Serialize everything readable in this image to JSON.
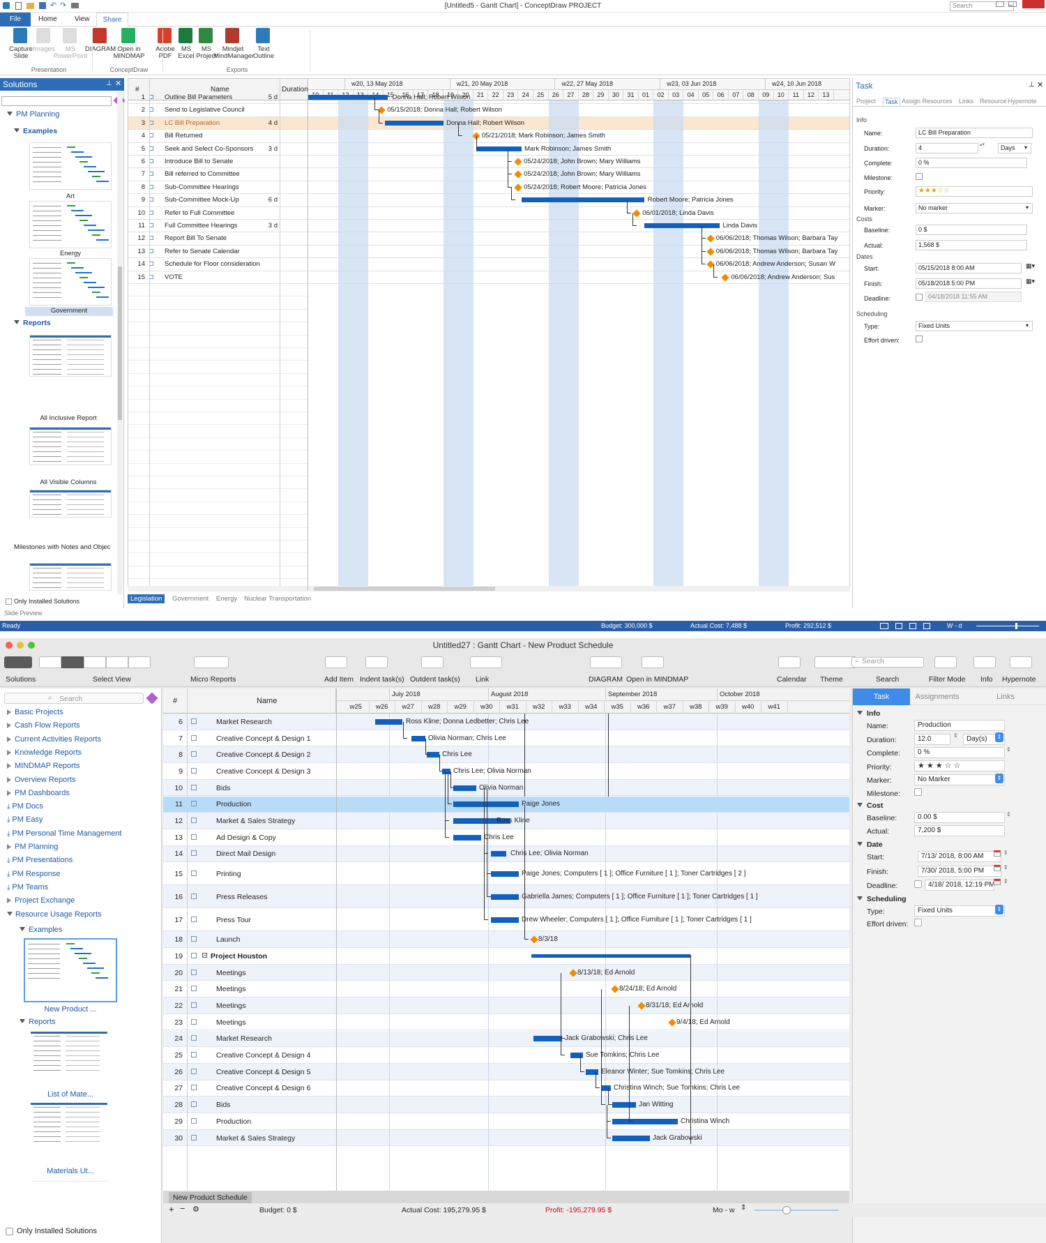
{
  "w1": {
    "title": "[Untitled5 - Gantt Chart] - ConceptDraw PROJECT",
    "search_placeholder": "Search",
    "tabs": [
      "File",
      "Home",
      "View",
      "Share"
    ],
    "ribbon": {
      "groups": [
        "Presentation",
        "ConceptDraw",
        "Exports"
      ],
      "buttons": [
        {
          "l1": "Capture",
          "l2": "Slide",
          "color": "#2d7ab8",
          "dis": false
        },
        {
          "l1": "Images",
          "l2": "",
          "color": "#bbb",
          "dis": true
        },
        {
          "l1": "MS",
          "l2": "PowerPoint",
          "color": "#bbb",
          "dis": true
        },
        {
          "l1": "DIAGRAM",
          "l2": "",
          "color": "#c0392b",
          "dis": false
        },
        {
          "l1": "Open in",
          "l2": "MINDMAP",
          "color": "#27ae60",
          "dis": false
        },
        {
          "l1": "Adobe",
          "l2": "PDF",
          "color": "#d9402b",
          "dis": false
        },
        {
          "l1": "MS",
          "l2": "Excel",
          "color": "#1d7a3e",
          "dis": false
        },
        {
          "l1": "MS",
          "l2": "Project",
          "color": "#2e8a3e",
          "dis": false
        },
        {
          "l1": "Mindjet",
          "l2": "MindManager",
          "color": "#b03a2e",
          "dis": false
        },
        {
          "l1": "Text",
          "l2": "Outline",
          "color": "#2d7ab8",
          "dis": false
        }
      ]
    },
    "solutions": {
      "title": "Solutions",
      "pm_planning": "PM Planning",
      "examples": "Examples",
      "reports": "Reports",
      "thumbs": [
        "Art",
        "Energy",
        "Government"
      ],
      "report_thumbs": [
        "All Inclusive Report",
        "All Visible Columns",
        "Milestones with Notes and Objec"
      ],
      "only_installed": "Only Installed Solutions",
      "slide_preview": "Slide Preview"
    },
    "grid": {
      "h_num": "#",
      "h_name": "Name",
      "h_dur": "Duration"
    },
    "tasks": [
      {
        "n": "1",
        "name": "Outline Bill Parameters",
        "dur": "5 d",
        "label": "Donna Hall; Robert Wilson"
      },
      {
        "n": "2",
        "name": "Send to Legislative Council",
        "dur": "",
        "label": "05/15/2018; Donna Hall; Robert Wilson"
      },
      {
        "n": "3",
        "name": "LC Bill Preparation",
        "dur": "4 d",
        "label": "Donna Hall; Robert Wilson"
      },
      {
        "n": "4",
        "name": "Bill Returned",
        "dur": "",
        "label": "05/21/2018; Mark Robinson; James Smith"
      },
      {
        "n": "5",
        "name": "Seek and Select Co-Sponsors",
        "dur": "3 d",
        "label": "Mark Robinson; James Smith"
      },
      {
        "n": "6",
        "name": "Introduce Bill to Senate",
        "dur": "",
        "label": "05/24/2018; John Brown; Mary Williams"
      },
      {
        "n": "7",
        "name": "Bill referred to Committee",
        "dur": "",
        "label": "05/24/2018; John Brown; Mary Williams"
      },
      {
        "n": "8",
        "name": "Sub-Committee Hearings",
        "dur": "",
        "label": "05/24/2018; Robert Moore; Patricia Jones"
      },
      {
        "n": "9",
        "name": "Sub-Committee Mock-Up",
        "dur": "6 d",
        "label": "Robert Moore; Patricia Jones"
      },
      {
        "n": "10",
        "name": "Refer to Full Committee",
        "dur": "",
        "label": "06/01/2018; Linda Davis"
      },
      {
        "n": "11",
        "name": "Full Committee Hearings",
        "dur": "3 d",
        "label": "Linda Davis"
      },
      {
        "n": "12",
        "name": "Report Bill To Senate",
        "dur": "",
        "label": "06/06/2018; Thomas Wilson; Barbara Tay"
      },
      {
        "n": "13",
        "name": "Refer to Senate Calendar",
        "dur": "",
        "label": "06/06/2018; Thomas Wilson; Barbara Tay"
      },
      {
        "n": "14",
        "name": "Schedule for Floor consideration",
        "dur": "",
        "label": "06/06/2018; Andrew Anderson; Susan W"
      },
      {
        "n": "15",
        "name": "VOTE",
        "dur": "",
        "label": "06/06/2018; Andrew Anderson; Sus"
      }
    ],
    "weeks": [
      "w20, 13 May 2018",
      "w21, 20 May 2018",
      "w22, 27 May 2018",
      "w23, 03 Jun 2018",
      "w24, 10 Jun 2018"
    ],
    "days": [
      "10",
      "11",
      "12",
      "13",
      "14",
      "15",
      "16",
      "17",
      "18",
      "19",
      "20",
      "21",
      "22",
      "23",
      "24",
      "25",
      "26",
      "27",
      "28",
      "29",
      "30",
      "31",
      "01",
      "02",
      "03",
      "04",
      "05",
      "06",
      "07",
      "08",
      "09",
      "10",
      "11",
      "12",
      "13"
    ],
    "sheet_tabs": [
      "Legislation",
      "Government",
      "Energy",
      "Nuclear Transportation"
    ],
    "task_panel": {
      "title": "Task",
      "tabs": [
        "Project",
        "Task",
        "Assign Resources",
        "Links",
        "Resource",
        "Hypernote"
      ],
      "info": "Info",
      "name_l": "Name:",
      "name": "LC Bill Preparation",
      "duration_l": "Duration:",
      "duration": "4",
      "duration_unit": "Days",
      "complete_l": "Complete:",
      "complete": "0 %",
      "milestone_l": "Milestone:",
      "priority_l": "Priority:",
      "priority": "★★★☆☆",
      "marker_l": "Marker:",
      "marker": "No marker",
      "costs": "Costs",
      "baseline_l": "Baseline:",
      "baseline": "0 $",
      "actual_l": "Actual:",
      "actual": "1,568 $",
      "dates": "Dates",
      "start_l": "Start:",
      "start": "05/15/2018   8:00 AM",
      "finish_l": "Finish:",
      "finish": "05/18/2018   5:00 PM",
      "deadline_l": "Deadline:",
      "deadline": "04/18/2018  11:55 AM",
      "scheduling": "Scheduling",
      "type_l": "Type:",
      "type": "Fixed Units",
      "effort_l": "Effort driven:"
    },
    "status": {
      "ready": "Ready",
      "budget": "Budget: 300,000 $",
      "actual": "Actual Cost: 7,488 $",
      "profit": "Profit: 292,512 $",
      "zoom": "W - d"
    }
  },
  "w2": {
    "title": "Untitled27 : Gantt Chart - New Product Schedule",
    "toolbar": [
      "Solutions",
      "Select View",
      "Micro Reports",
      "Add Item",
      "Indent task(s)",
      "Outdent task(s)",
      "Link",
      "DIAGRAM",
      "Open in MINDMAP",
      "Calendar",
      "Theme",
      "Search",
      "Filter Mode",
      "Info",
      "Hypernote"
    ],
    "search_placeholder": "Search",
    "sidebar_search": "Search",
    "tree": [
      {
        "t": "Basic Projects",
        "k": "c"
      },
      {
        "t": "Cash Flow Reports",
        "k": "c"
      },
      {
        "t": "Current Activities Reports",
        "k": "c"
      },
      {
        "t": "Knowledge Reports",
        "k": "c"
      },
      {
        "t": "MINDMAP Reports",
        "k": "c"
      },
      {
        "t": "Overview Reports",
        "k": "c"
      },
      {
        "t": "PM Dashboards",
        "k": "c"
      },
      {
        "t": "PM Docs",
        "k": "d"
      },
      {
        "t": "PM Easy",
        "k": "d"
      },
      {
        "t": "PM Personal Time Management",
        "k": "d"
      },
      {
        "t": "PM Planning",
        "k": "c"
      },
      {
        "t": "PM Presentations",
        "k": "d"
      },
      {
        "t": "PM Response",
        "k": "d"
      },
      {
        "t": "PM Teams",
        "k": "d"
      },
      {
        "t": "Project Exchange",
        "k": "c"
      },
      {
        "t": "Resource Usage Reports",
        "k": "o"
      }
    ],
    "examples": "Examples",
    "reports": "Reports",
    "thumbs": [
      "New Product ...",
      "List of Mate...",
      "Materials Ut..."
    ],
    "only_installed": "Only Installed Solutions",
    "grid": {
      "h_num": "#",
      "h_name": "Name"
    },
    "months": [
      "July 2018",
      "August 2018",
      "September 2018",
      "October 2018"
    ],
    "weeks": [
      "w25",
      "w26",
      "w27",
      "w28",
      "w29",
      "w30",
      "w31",
      "w32",
      "w33",
      "w34",
      "w35",
      "w36",
      "w37",
      "w38",
      "w39",
      "w40",
      "w41"
    ],
    "tasks": [
      {
        "n": "6",
        "name": "Market Research",
        "label": "Ross Kline; Donna Ledbetter; Chris Lee"
      },
      {
        "n": "7",
        "name": "Creative Concept & Design 1",
        "label": "Olivia Norman; Chris Lee"
      },
      {
        "n": "8",
        "name": "Creative Concept & Design 2",
        "label": "Chris Lee"
      },
      {
        "n": "9",
        "name": "Creative Concept & Design 3",
        "label": "Chris Lee; Olivia Norman"
      },
      {
        "n": "10",
        "name": "Bids",
        "label": "Olivia Norman"
      },
      {
        "n": "11",
        "name": "Production",
        "label": "Paige Jones"
      },
      {
        "n": "12",
        "name": "Market & Sales Strategy",
        "label": "Ross Kline"
      },
      {
        "n": "13",
        "name": "Ad Design & Copy",
        "label": "Chris Lee"
      },
      {
        "n": "14",
        "name": "Direct Mail Design",
        "label": "Chris Lee; Olivia Norman"
      },
      {
        "n": "15",
        "name": "Printing",
        "label": "Paige Jones; Computers [ 1 ]; Office Furniture [ 1 ]; Toner Cartridges [ 2 ]"
      },
      {
        "n": "16",
        "name": "Press Releases",
        "label": "Gabriella  James; Computers [ 1 ]; Office Furniture [ 1 ]; Toner Cartridges [ 1 ]"
      },
      {
        "n": "17",
        "name": "Press Tour",
        "label": "Drew Wheeler; Computers [ 1 ]; Office Furniture [ 1 ]; Toner Cartridges [ 1 ]"
      },
      {
        "n": "18",
        "name": "Launch",
        "label": "8/3/18"
      },
      {
        "n": "19",
        "name": "Project Houston",
        "label": ""
      },
      {
        "n": "20",
        "name": "Meetings",
        "label": "8/13/18; Ed Arnold"
      },
      {
        "n": "21",
        "name": "Meetings",
        "label": "8/24/18; Ed Arnold"
      },
      {
        "n": "22",
        "name": "Meetings",
        "label": "8/31/18; Ed Arnold"
      },
      {
        "n": "23",
        "name": "Meetings",
        "label": "9/4/18; Ed Arnold"
      },
      {
        "n": "24",
        "name": "Market Research",
        "label": "Jack Grabowski; Chris Lee"
      },
      {
        "n": "25",
        "name": "Creative Concept & Design 4",
        "label": "Sue Tomkins; Chris Lee"
      },
      {
        "n": "26",
        "name": "Creative Concept & Design 5",
        "label": "Eleanor Winter; Sue Tomkins; Chris Lee"
      },
      {
        "n": "27",
        "name": "Creative Concept & Design 6",
        "label": "Christina Winch; Sue Tomkins; Chris Lee"
      },
      {
        "n": "28",
        "name": "Bids",
        "label": "Jan Witting"
      },
      {
        "n": "29",
        "name": "Production",
        "label": "Christina Winch"
      },
      {
        "n": "30",
        "name": "Market & Sales Strategy",
        "label": "Jack Grabowski"
      }
    ],
    "panel": {
      "tabs": [
        "Task",
        "Assignments",
        "Links"
      ],
      "info": "Info",
      "name_l": "Name:",
      "name": "Production",
      "duration_l": "Duration:",
      "duration": "12.0",
      "duration_unit": "Day(s)",
      "complete_l": "Complete:",
      "complete": "0 %",
      "priority_l": "Priority:",
      "priority": "★★★☆☆",
      "marker_l": "Marker:",
      "marker": "No Marker",
      "milestone_l": "Milestone:",
      "cost": "Cost",
      "baseline_l": "Baseline:",
      "baseline": "0.00 $",
      "actual_l": "Actual:",
      "actual": "7,200 $",
      "date": "Date",
      "start_l": "Start:",
      "start": "7/13/ 2018,  8:00 AM",
      "finish_l": "Finish:",
      "finish": "7/30/ 2018,  5:00 PM",
      "deadline_l": "Deadline:",
      "deadline": "4/18/ 2018, 12:19 PM",
      "scheduling": "Scheduling",
      "type_l": "Type:",
      "type": "Fixed Units",
      "effort_l": "Effort driven:"
    },
    "sheet_tab": "New Product Schedule",
    "status": {
      "budget": "Budget: 0 $",
      "actual": "Actual Cost: 195,279.95 $",
      "profit": "Profit: -195,279.95 $",
      "zoom": "Mo - w"
    }
  }
}
